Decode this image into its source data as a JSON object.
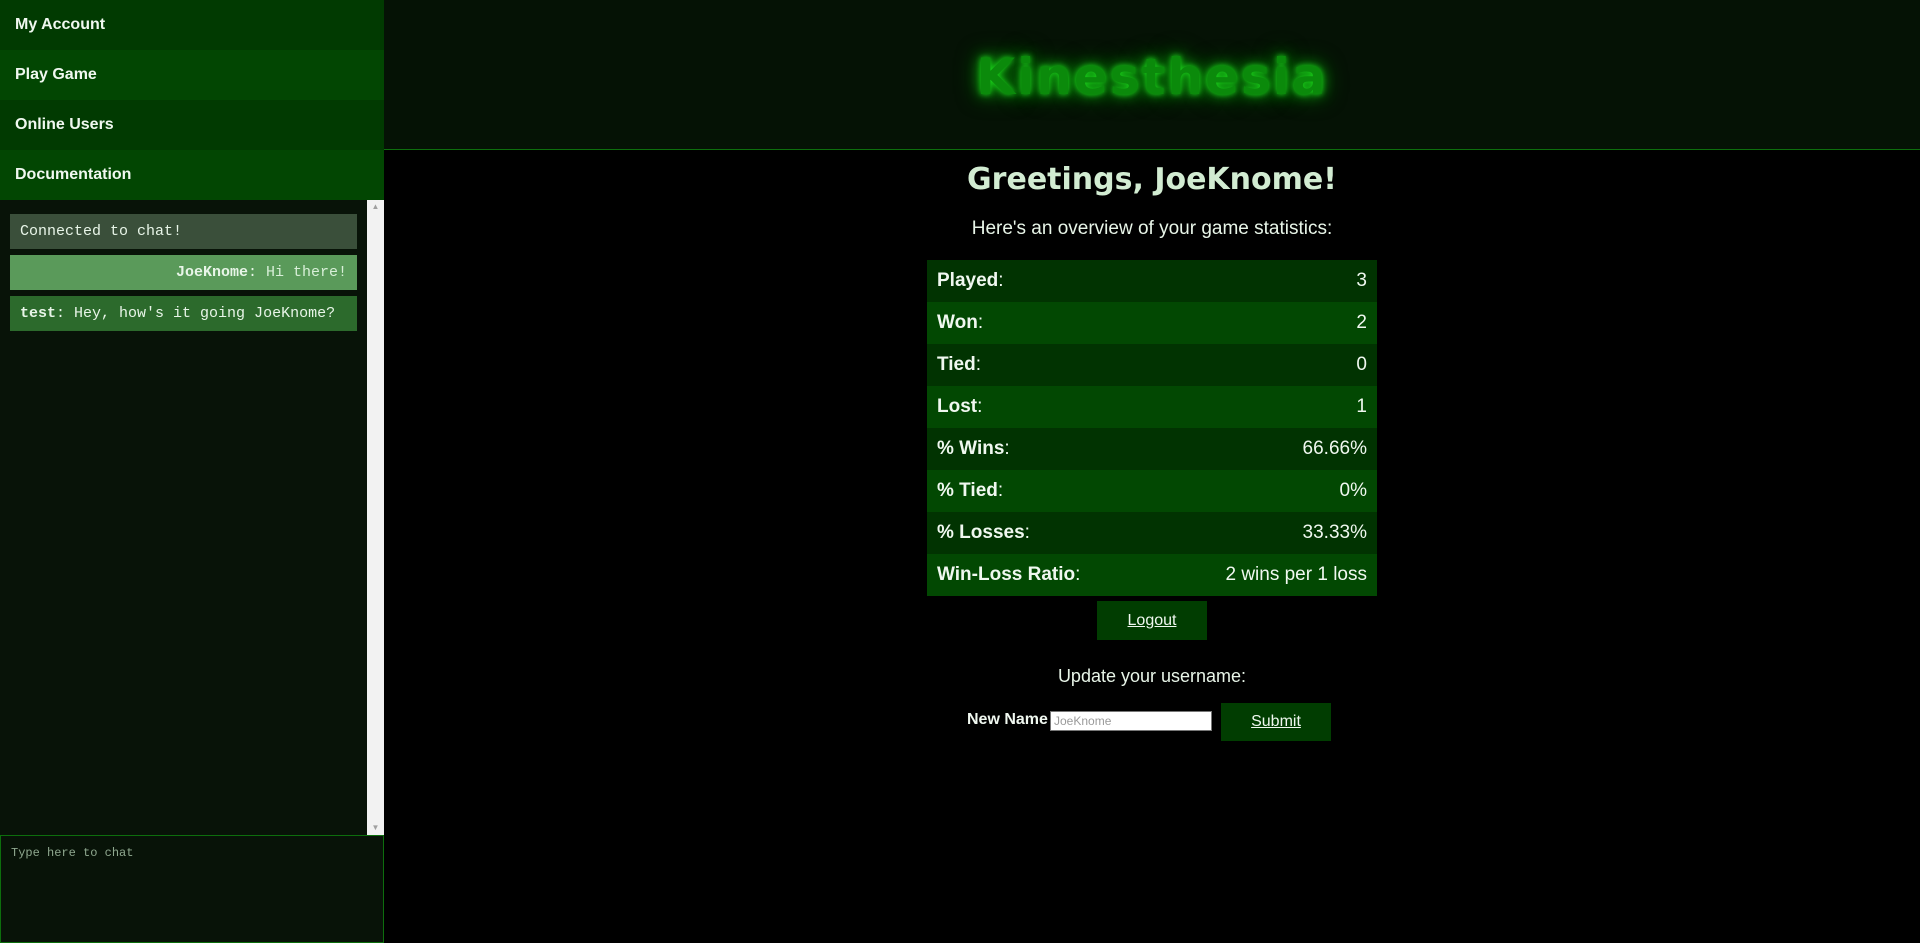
{
  "sidebar": {
    "items": [
      {
        "label": "My Account"
      },
      {
        "label": "Play Game"
      },
      {
        "label": "Online Users"
      },
      {
        "label": "Documentation"
      }
    ]
  },
  "chat": {
    "messages": [
      {
        "text": "Connected to chat!"
      },
      {
        "user": "JoeKnome",
        "sep": ":",
        "text": " Hi there!"
      },
      {
        "user": "test",
        "sep": ":",
        "text": " Hey, how's it going JoeKnome?"
      }
    ],
    "input_placeholder": "Type here to chat",
    "scroll_up_icon": "triangle-up",
    "scroll_down_icon": "triangle-down"
  },
  "header": {
    "title": "Kinesthesia"
  },
  "main": {
    "greeting": "Greetings, JoeKnome!",
    "overview": "Here's an overview of your game statistics:",
    "stats": [
      {
        "label": "Played",
        "value": "3"
      },
      {
        "label": "Won",
        "value": "2"
      },
      {
        "label": "Tied",
        "value": "0"
      },
      {
        "label": "Lost",
        "value": "1"
      },
      {
        "label": "% Wins",
        "value": "66.66%"
      },
      {
        "label": "% Tied",
        "value": "0%"
      },
      {
        "label": "% Losses",
        "value": "33.33%"
      },
      {
        "label": "Win-Loss Ratio",
        "value": "2 wins per 1 loss"
      }
    ],
    "colon": ":",
    "logout_label": "Logout",
    "update_label": "Update your username:",
    "new_name_label": "New Name",
    "new_name_placeholder": "JoeKnome",
    "submit_label": "Submit"
  },
  "colors": {
    "background": "#000000",
    "sidebar_bg": "#081308",
    "accent_green": "#0b8a0b",
    "border_green": "#0d6e0d"
  }
}
